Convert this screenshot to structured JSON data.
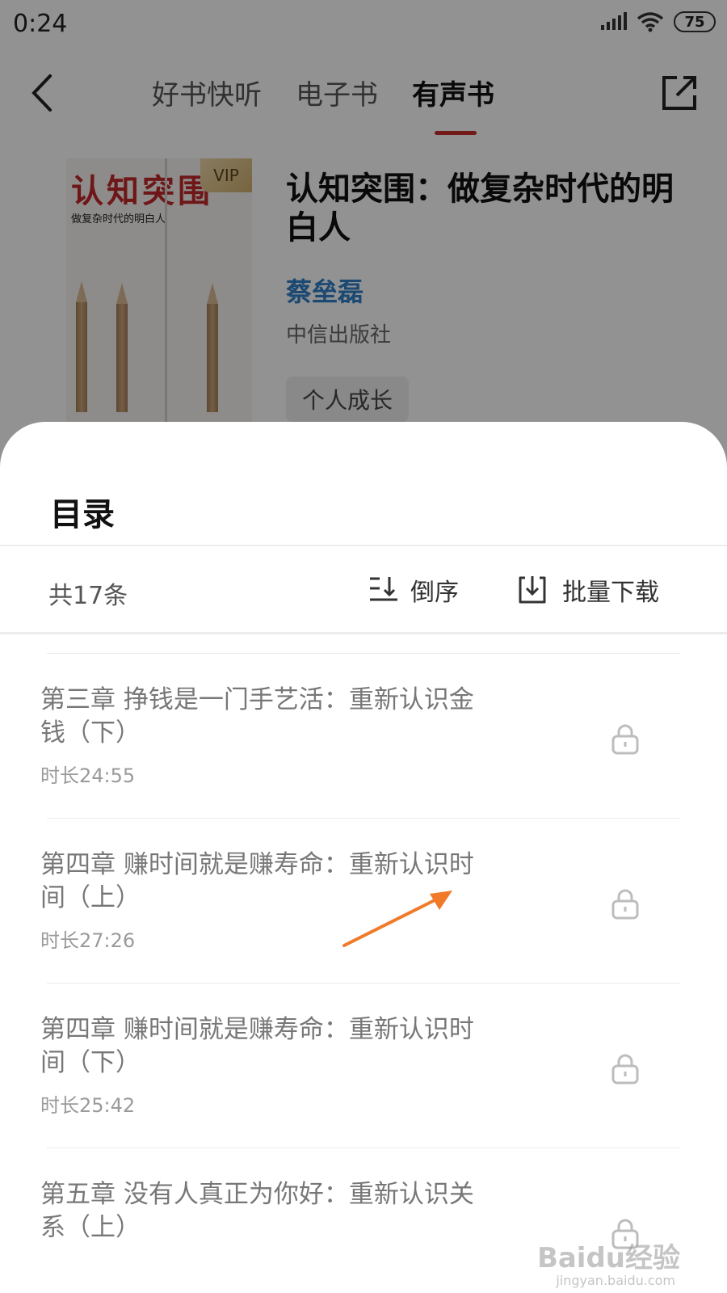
{
  "status_bar": {
    "time": "0:24",
    "battery": "75"
  },
  "nav": {
    "tabs": [
      {
        "label": "好书快听"
      },
      {
        "label": "电子书"
      },
      {
        "label": "有声书"
      }
    ],
    "active_tab_index": 2
  },
  "book": {
    "cover_title": "认知突围",
    "cover_subtitle": "做复杂时代的明白人",
    "vip_badge": "VIP",
    "title": "认知突围：做复杂时代的明白人",
    "author": "蔡垒磊",
    "publisher": "中信出版社",
    "tag": "个人成长"
  },
  "sheet": {
    "title": "目录",
    "count": "共17条",
    "sort_label": "倒序",
    "download_label": "批量下载"
  },
  "chapters": [
    {
      "title": "第三章 挣钱是一门手艺活：重新认识金钱（下）",
      "duration": "时长24:55"
    },
    {
      "title": "第四章 赚时间就是赚寿命：重新认识时间（上）",
      "duration": "时长27:26"
    },
    {
      "title": "第四章 赚时间就是赚寿命：重新认识时间（下）",
      "duration": "时长25:42"
    },
    {
      "title": "第五章 没有人真正为你好：重新认识关系（上）",
      "duration": ""
    }
  ],
  "colors": {
    "accent_red": "#c42b2b",
    "author_blue": "#2f7fc6",
    "annotation_orange": "#f07a2a"
  },
  "watermark": {
    "main": "Baidu经验",
    "sub": "jingyan.baidu.com"
  }
}
